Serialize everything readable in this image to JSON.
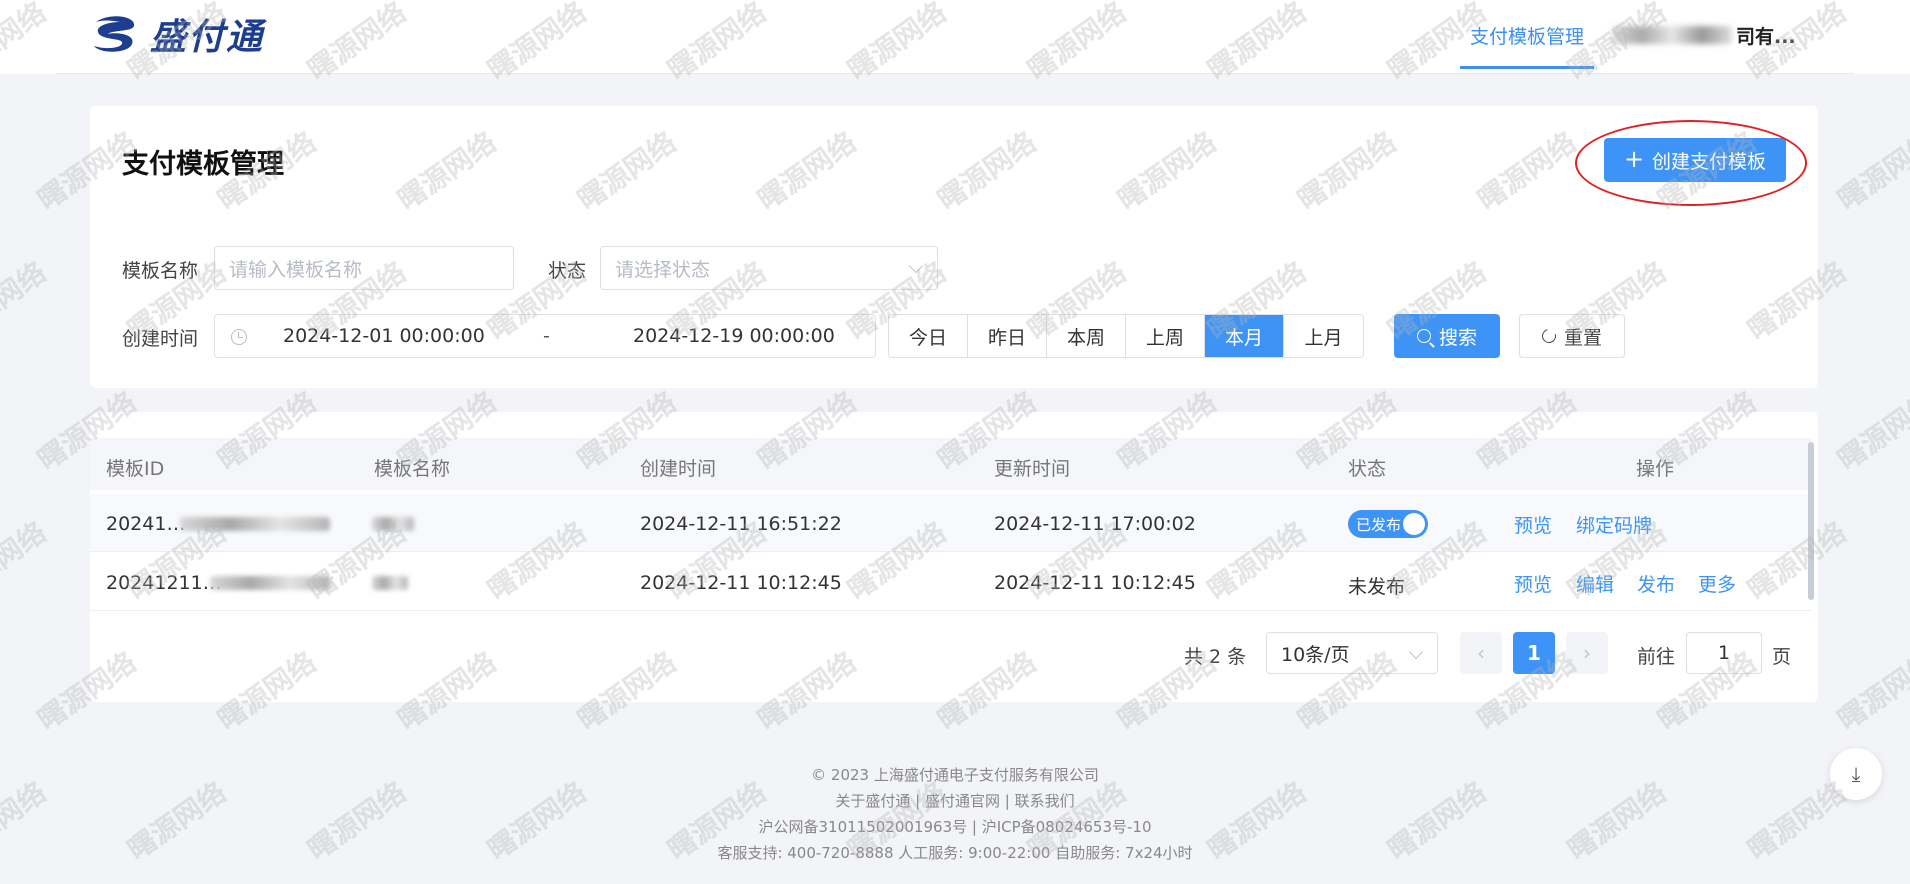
{
  "brand": {
    "name": "盛付通"
  },
  "header": {
    "active_tab": "支付模板管理",
    "user_suffix": "司有..."
  },
  "page": {
    "title": "支付模板管理",
    "create_button": "创建支付模板"
  },
  "filters": {
    "name_label": "模板名称",
    "name_placeholder": "请输入模板名称",
    "status_label": "状态",
    "status_placeholder": "请选择状态",
    "created_label": "创建时间",
    "date_start": "2024-12-01 00:00:00",
    "date_separator": "-",
    "date_end": "2024-12-19 00:00:00",
    "quick_ranges": [
      "今日",
      "昨日",
      "本周",
      "上周",
      "本月",
      "上月"
    ],
    "quick_active": "本月",
    "search_button": "搜索",
    "reset_button": "重置"
  },
  "table": {
    "columns": [
      "模板ID",
      "模板名称",
      "创建时间",
      "更新时间",
      "状态",
      "操作"
    ],
    "rows": [
      {
        "id": "20241…",
        "name": "",
        "created": "2024-12-11 16:51:22",
        "updated": "2024-12-11 17:00:02",
        "status": "已发布",
        "actions": [
          "预览",
          "绑定码牌"
        ]
      },
      {
        "id": "20241211…",
        "name": "",
        "created": "2024-12-11 10:12:45",
        "updated": "2024-12-11 10:12:45",
        "status": "未发布",
        "actions": [
          "预览",
          "编辑",
          "发布",
          "更多"
        ]
      }
    ]
  },
  "pagination": {
    "total": "共 2 条",
    "page_size": "10条/页",
    "current_page": "1",
    "goto_label": "前往",
    "goto_value": "1",
    "page_unit": "页"
  },
  "footer": {
    "line1": "© 2023 上海盛付通电子支付服务有限公司",
    "line2": "关于盛付通 | 盛付通官网 | 联系我们",
    "line3": "沪公网备31011502001963号 | 沪ICP备08024653号-10",
    "line4": "客服支持: 400-720-8888   人工服务: 9:00-22:00   自助服务: 7x24小时"
  },
  "watermark": "曙源网络",
  "colors": {
    "primary": "#3d94f6",
    "highlight_ellipse": "#e02020",
    "logo": "#1d3e8f"
  }
}
